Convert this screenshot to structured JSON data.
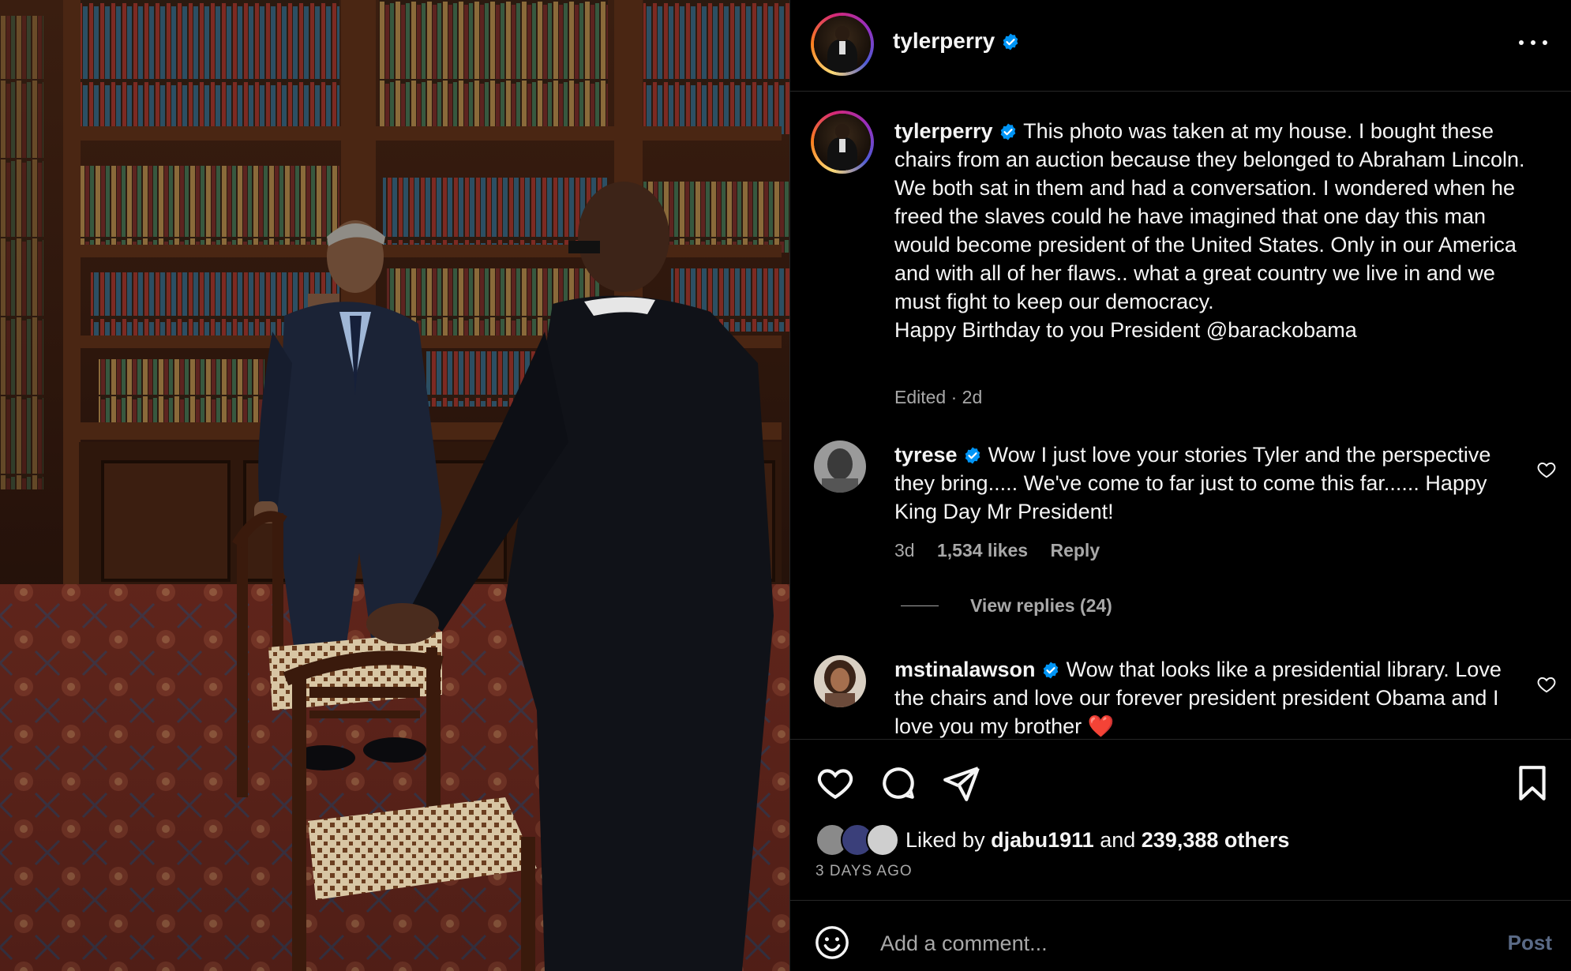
{
  "header": {
    "username": "tylerperry",
    "verified_icon": "verified-badge-icon",
    "more_icon": "more-options-icon"
  },
  "caption": {
    "username": "tylerperry",
    "text": "This photo was taken at my house. I bought these chairs from an auction because they belonged to Abraham Lincoln. We both sat in them and had a conversation. I wondered when he freed the slaves could he have imagined that one day this man would become president of the United States. Only in our America and with all of her flaws.. what a great country we live in and we must fight to keep our democracy.",
    "text2": "Happy Birthday to you President @barackobama",
    "meta": "Edited · 2d"
  },
  "comments": [
    {
      "username": "tyrese",
      "text": "Wow I just love your stories Tyler and the perspective they bring..... We've come to far just to come this far...... Happy King Day Mr President!",
      "time": "3d",
      "likes": "1,534 likes",
      "reply": "Reply",
      "view_replies": "View replies (24)"
    },
    {
      "username": "mstinalawson",
      "text": "Wow that looks like a presidential library. Love the chairs and love our forever president president Obama and I love you my brother ❤️"
    }
  ],
  "actions": {
    "liked_by_prefix": "Liked by",
    "liked_by_user": "djabu1911",
    "liked_by_and": "and",
    "liked_by_others": "239,388 others",
    "date": "3 DAYS AGO"
  },
  "composer": {
    "placeholder": "Add a comment...",
    "post_label": "Post"
  },
  "colors": {
    "background": "#000000",
    "text": "#f5f5f5",
    "muted": "#a8a8a8",
    "verified": "#0095f6",
    "post_disabled": "#5a6a86"
  }
}
